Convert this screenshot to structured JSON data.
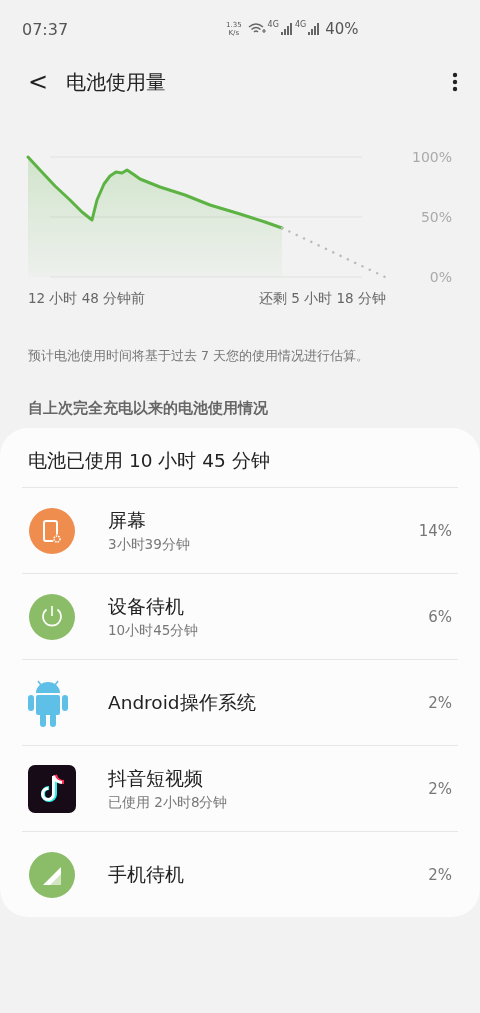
{
  "status_bar": {
    "time": "07:37",
    "speed_value": "1.35",
    "speed_unit": "K/s",
    "network_labels": [
      "4G",
      "4G"
    ],
    "battery": "40%"
  },
  "header": {
    "back": "<",
    "title": "电池使用量"
  },
  "chart": {
    "y_labels": [
      "100%",
      "50%",
      "0%"
    ],
    "start_label": "12 小时 48 分钟前",
    "end_label": "还剩 5 小时 18 分钟"
  },
  "note": "预计电池使用时间将基于过去 7 天您的使用情况进行估算。",
  "section_title": "自上次完全充电以来的电池使用情况",
  "card": {
    "title": "电池已使用 10 小时 45 分钟",
    "items": [
      {
        "name": "屏幕",
        "detail": "3小时39分钟",
        "percent": "14%"
      },
      {
        "name": "设备待机",
        "detail": "10小时45分钟",
        "percent": "6%"
      },
      {
        "name": "Android操作系统",
        "percent": "2%"
      },
      {
        "name": "抖音短视频",
        "detail": "已使用 2小时8分钟",
        "percent": "2%"
      },
      {
        "name": "手机待机",
        "percent": "2%"
      }
    ]
  }
}
